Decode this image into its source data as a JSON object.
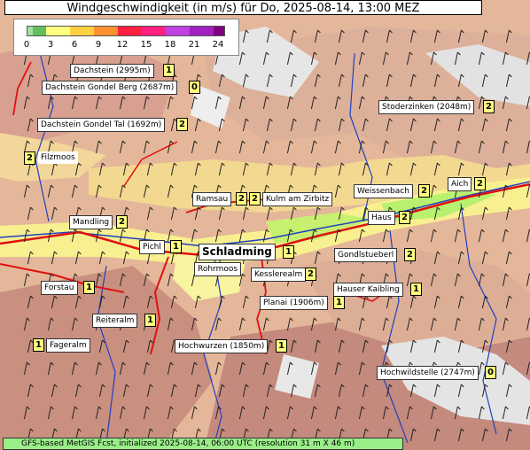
{
  "title": "Windgeschwindigkeit (in m/s) für Do, 2025-08-14, 13:00 MEZ",
  "legend": {
    "ticks": [
      "0",
      "3",
      "6",
      "9",
      "12",
      "15",
      "18",
      "21",
      "24"
    ],
    "colors": [
      "#a0e0a0",
      "#60c060",
      "#ffff80",
      "#ffd040",
      "#ff9030",
      "#ff2040",
      "#ff2080",
      "#c040e0",
      "#a020c0",
      "#800080"
    ]
  },
  "places": [
    {
      "name": "Dachstein (2995m)",
      "value": "1"
    },
    {
      "name": "Dachstein Gondel Berg (2687m)",
      "value": "0"
    },
    {
      "name": "Dachstein Gondel Tal (1692m)",
      "value": "2"
    },
    {
      "name": "Filzmoos",
      "value": "2"
    },
    {
      "name": "Stoderzinken (2048m)",
      "value": "2"
    },
    {
      "name": "Ramsau",
      "value": "2"
    },
    {
      "name": "Kulm am Zirbitz",
      "value": "2"
    },
    {
      "name": "Weissenbach",
      "value": "2"
    },
    {
      "name": "Aich",
      "value": "2"
    },
    {
      "name": "Mandling",
      "value": "2"
    },
    {
      "name": "Haus",
      "value": "2"
    },
    {
      "name": "Pichl",
      "value": "1"
    },
    {
      "name": "Schladming",
      "value": "1"
    },
    {
      "name": "Gondlstueberl",
      "value": "2"
    },
    {
      "name": "Rohrmoos",
      "value": ""
    },
    {
      "name": "Kesslerealm",
      "value": "2"
    },
    {
      "name": "Forstau",
      "value": "1"
    },
    {
      "name": "Hauser Kaibling",
      "value": "1"
    },
    {
      "name": "Planai (1906m)",
      "value": "1"
    },
    {
      "name": "Reiteralm",
      "value": "1"
    },
    {
      "name": "Fageralm",
      "value": "1"
    },
    {
      "name": "Hochwurzen (1850m)",
      "value": "1"
    },
    {
      "name": "Hochwildstelle (2747m)",
      "value": "0"
    }
  ],
  "footer": "GFS-based MetGIS Fcst, initialized 2025-08-14, 06:00 UTC (resolution 31 m X 46 m)",
  "colors": {
    "terrain_low": "#ffff99",
    "terrain_mid": "#f0b070",
    "terrain_high": "#c08070",
    "rock": "#e8e8e8",
    "river": "#2040c0",
    "road": "#e01010"
  },
  "icons": {
    "wind": "wind-barb-icon"
  }
}
